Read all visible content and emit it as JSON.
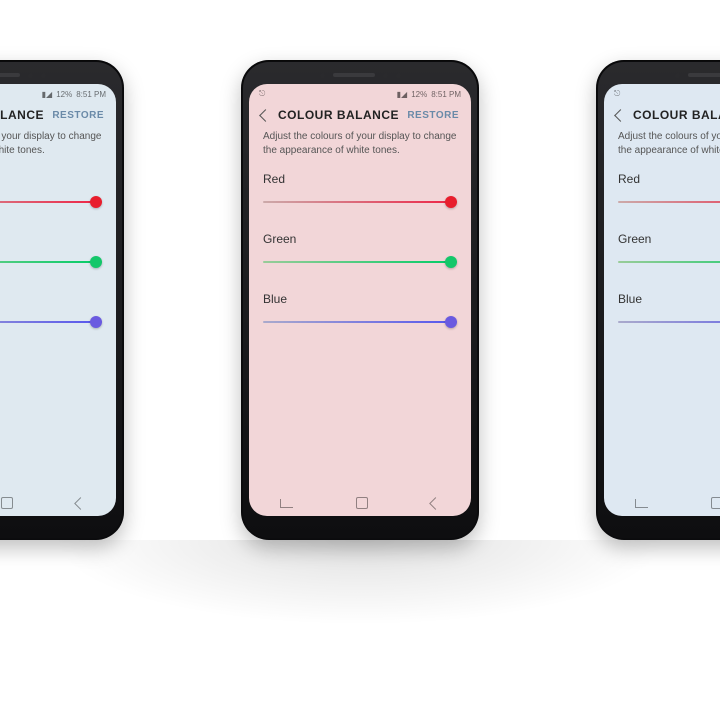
{
  "status": {
    "time": "8:51 PM",
    "battery": "12%"
  },
  "header": {
    "title": "COLOUR BALANCE",
    "restore": "RESTORE"
  },
  "description": "Adjust the colours of your display to change the appearance of white tones.",
  "sliders": {
    "red": {
      "label": "Red",
      "value": 100
    },
    "green": {
      "label": "Green",
      "value": 100
    },
    "blue": {
      "label": "Blue",
      "value": 100
    }
  },
  "phones": [
    {
      "position": "left",
      "screen_tint": "tint-blue"
    },
    {
      "position": "center",
      "screen_tint": "tint-red"
    },
    {
      "position": "right",
      "screen_tint": "tint-blue2"
    }
  ]
}
